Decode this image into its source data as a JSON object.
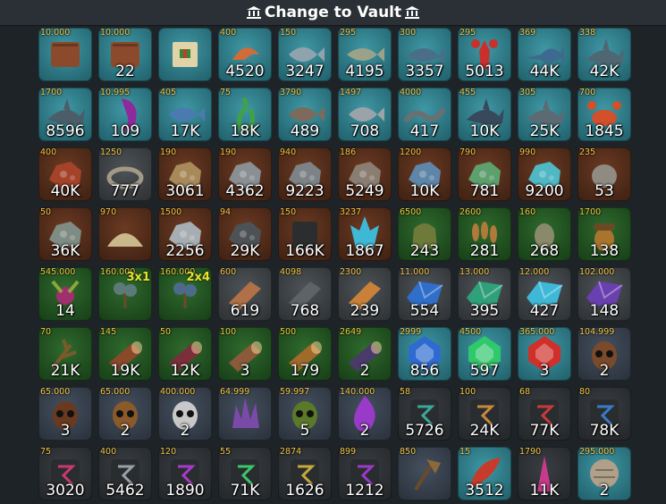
{
  "header": {
    "title": "Change to Vault",
    "icon": "vault-icon"
  },
  "rows": [
    [
      {
        "name": "book-icon",
        "price": "10.000",
        "count": "",
        "bg": "teal",
        "color": "#8b4a2b"
      },
      {
        "name": "book-icon",
        "price": "10.000",
        "count": "22",
        "bg": "teal",
        "color": "#8b4a2b"
      },
      {
        "name": "scroll-icon",
        "price": "",
        "count": "",
        "bg": "teal",
        "color": "#e0d3a8"
      },
      {
        "name": "shrimp-icon",
        "price": "400",
        "count": "4520",
        "bg": "teal",
        "color": "#d06b3a"
      },
      {
        "name": "fish-icon",
        "price": "150",
        "count": "3247",
        "bg": "teal",
        "color": "#8fa3ad"
      },
      {
        "name": "trout-icon",
        "price": "295",
        "count": "4195",
        "bg": "teal",
        "color": "#9aa38a"
      },
      {
        "name": "tuna-icon",
        "price": "300",
        "count": "3357",
        "bg": "teal",
        "color": "#4a6d88"
      },
      {
        "name": "lobster-icon",
        "price": "295",
        "count": "5013",
        "bg": "teal",
        "color": "#c9302c"
      },
      {
        "name": "swordfish-icon",
        "price": "369",
        "count": "44K",
        "bg": "teal",
        "color": "#3e6a8f"
      },
      {
        "name": "shark-icon",
        "price": "338",
        "count": "42K",
        "bg": "teal",
        "color": "#4f6673"
      }
    ],
    [
      {
        "name": "shark-icon",
        "price": "1700",
        "count": "8596",
        "bg": "teal",
        "color": "#4b5d68"
      },
      {
        "name": "tentacle-icon",
        "price": "10.995",
        "count": "109",
        "bg": "teal",
        "color": "#8f2a9c"
      },
      {
        "name": "fish-icon",
        "price": "405",
        "count": "17K",
        "bg": "teal",
        "color": "#4a7bb0"
      },
      {
        "name": "seaweed-icon",
        "price": "75",
        "count": "18K",
        "bg": "teal",
        "color": "#3fa346"
      },
      {
        "name": "fish-icon",
        "price": "3790",
        "count": "489",
        "bg": "teal",
        "color": "#7e6a5c"
      },
      {
        "name": "fish-icon",
        "price": "1497",
        "count": "708",
        "bg": "teal",
        "color": "#9aa3a8"
      },
      {
        "name": "eel-icon",
        "price": "4000",
        "count": "417",
        "bg": "teal",
        "color": "#6a6f72"
      },
      {
        "name": "shark-icon",
        "price": "455",
        "count": "10K",
        "bg": "teal",
        "color": "#37495a"
      },
      {
        "name": "shark-icon",
        "price": "305",
        "count": "25K",
        "bg": "teal",
        "color": "#5c6a73"
      },
      {
        "name": "crab-icon",
        "price": "700",
        "count": "1845",
        "bg": "teal",
        "color": "#d2502a"
      }
    ],
    [
      {
        "name": "ore-icon",
        "price": "400",
        "count": "40K",
        "bg": "brown",
        "color": "#a4432a"
      },
      {
        "name": "nest-icon",
        "price": "1250",
        "count": "777",
        "bg": "gray",
        "color": "#a39a86"
      },
      {
        "name": "ore-icon",
        "price": "190",
        "count": "3061",
        "bg": "brown",
        "color": "#a88a5a"
      },
      {
        "name": "ore-icon",
        "price": "190",
        "count": "4362",
        "bg": "brown",
        "color": "#8a8f93"
      },
      {
        "name": "ore-icon",
        "price": "940",
        "count": "9223",
        "bg": "brown",
        "color": "#7d8287"
      },
      {
        "name": "ore-icon",
        "price": "186",
        "count": "5249",
        "bg": "brown",
        "color": "#8a7d72"
      },
      {
        "name": "ore-icon",
        "price": "1200",
        "count": "10K",
        "bg": "brown",
        "color": "#5f86a8"
      },
      {
        "name": "ore-icon",
        "price": "790",
        "count": "781",
        "bg": "brown",
        "color": "#5e9f6e"
      },
      {
        "name": "ore-icon",
        "price": "990",
        "count": "9200",
        "bg": "brown",
        "color": "#4fb8c4"
      },
      {
        "name": "stone-icon",
        "price": "235",
        "count": "53",
        "bg": "brown",
        "color": "#8f8a82"
      }
    ],
    [
      {
        "name": "ore-icon",
        "price": "50",
        "count": "36K",
        "bg": "brown",
        "color": "#7f8c84"
      },
      {
        "name": "sand-icon",
        "price": "970",
        "count": "",
        "bg": "brown",
        "color": "#c9b98a"
      },
      {
        "name": "ore-icon",
        "price": "1500",
        "count": "2256",
        "bg": "brown",
        "color": "#a7aeb3"
      },
      {
        "name": "ore-icon",
        "price": "94",
        "count": "29K",
        "bg": "brown",
        "color": "#4d5256"
      },
      {
        "name": "coal-icon",
        "price": "150",
        "count": "166K",
        "bg": "brown",
        "color": "#2b2d2f"
      },
      {
        "name": "crystal-icon",
        "price": "3237",
        "count": "1867",
        "bg": "brown",
        "color": "#3fb8d6"
      },
      {
        "name": "seed-bag-icon",
        "price": "6500",
        "count": "243",
        "bg": "green",
        "color": "#6d7a3a"
      },
      {
        "name": "wheat-icon",
        "price": "2600",
        "count": "281",
        "bg": "green",
        "color": "#b07a3a"
      },
      {
        "name": "seed-icon",
        "price": "160",
        "count": "268",
        "bg": "green",
        "color": "#8a8a6a"
      },
      {
        "name": "acorn-icon",
        "price": "1700",
        "count": "138",
        "bg": "green",
        "color": "#a9752e"
      }
    ],
    [
      {
        "name": "plant-icon",
        "price": "545.000",
        "count": "14",
        "bg": "green",
        "color": "#a02f6e"
      },
      {
        "name": "sapling-icon",
        "price": "160.000",
        "count": "",
        "size": "3x1",
        "bg": "green",
        "color": "#5c7a7a"
      },
      {
        "name": "sapling-icon",
        "price": "160.000",
        "count": "",
        "size": "2x4",
        "bg": "green",
        "color": "#4c6a8a"
      },
      {
        "name": "plank-icon",
        "price": "600",
        "count": "619",
        "bg": "gray",
        "color": "#b07048"
      },
      {
        "name": "plank-icon",
        "price": "4098",
        "count": "768",
        "bg": "gray",
        "color": "#5e6366"
      },
      {
        "name": "plank-icon",
        "price": "2300",
        "count": "239",
        "bg": "gray",
        "color": "#c9813a"
      },
      {
        "name": "gem-icon",
        "price": "11.000",
        "count": "554",
        "bg": "gray",
        "color": "#2f6ec9"
      },
      {
        "name": "gem-icon",
        "price": "13.000",
        "count": "395",
        "bg": "gray",
        "color": "#2fa07a"
      },
      {
        "name": "gem-icon",
        "price": "12.000",
        "count": "427",
        "bg": "gray",
        "color": "#3fb8d8"
      },
      {
        "name": "gem-icon",
        "price": "102.000",
        "count": "148",
        "bg": "gray",
        "color": "#6a3fb0"
      }
    ],
    [
      {
        "name": "branch-icon",
        "price": "70",
        "count": "21K",
        "bg": "green",
        "color": "#7a5a2a"
      },
      {
        "name": "log-icon",
        "price": "145",
        "count": "19K",
        "bg": "green",
        "color": "#8a4a2a"
      },
      {
        "name": "log-icon",
        "price": "50",
        "count": "12K",
        "bg": "green",
        "color": "#7a2f3a"
      },
      {
        "name": "log-icon",
        "price": "100",
        "count": "3",
        "bg": "green",
        "color": "#8a5a3a"
      },
      {
        "name": "log-icon",
        "price": "500",
        "count": "179",
        "bg": "green",
        "color": "#a06a2a"
      },
      {
        "name": "log-icon",
        "price": "2649",
        "count": "2",
        "bg": "green",
        "color": "#4a3a6a"
      },
      {
        "name": "jewel-icon",
        "price": "2999",
        "count": "856",
        "bg": "teal",
        "color": "#2f6ad0"
      },
      {
        "name": "jewel-icon",
        "price": "4500",
        "count": "597",
        "bg": "teal",
        "color": "#2fc86a"
      },
      {
        "name": "jewel-icon",
        "price": "365.000",
        "count": "3",
        "bg": "teal",
        "color": "#d0302a"
      },
      {
        "name": "mask-icon",
        "price": "104.999",
        "count": "2",
        "bg": "slate",
        "color": "#7a4a2a"
      }
    ],
    [
      {
        "name": "mask-icon",
        "price": "65.000",
        "count": "3",
        "bg": "slate",
        "color": "#6a3a1f"
      },
      {
        "name": "mask-icon",
        "price": "65.000",
        "count": "2",
        "bg": "slate",
        "color": "#8a5a2a"
      },
      {
        "name": "mask-icon",
        "price": "400.000",
        "count": "2",
        "bg": "slate",
        "color": "#c8c8c8"
      },
      {
        "name": "crystal-cluster-icon",
        "price": "64.999",
        "count": "",
        "bg": "slate",
        "color": "#7a4aa8"
      },
      {
        "name": "mask-icon",
        "price": "59.997",
        "count": "5",
        "bg": "slate",
        "color": "#5a7a2a"
      },
      {
        "name": "flame-icon",
        "price": "140.000",
        "count": "2",
        "bg": "slate",
        "color": "#9a3ac8"
      },
      {
        "name": "rune-icon",
        "price": "58",
        "count": "5726",
        "bg": "dark",
        "color": "#3aa89a"
      },
      {
        "name": "rune-icon",
        "price": "100",
        "count": "24K",
        "bg": "dark",
        "color": "#c88a3a"
      },
      {
        "name": "rune-icon",
        "price": "68",
        "count": "77K",
        "bg": "dark",
        "color": "#c83a3a"
      },
      {
        "name": "rune-icon",
        "price": "80",
        "count": "78K",
        "bg": "dark",
        "color": "#3a7ac8"
      }
    ],
    [
      {
        "name": "rune-icon",
        "price": "75",
        "count": "3020",
        "bg": "dark",
        "color": "#c83a6a"
      },
      {
        "name": "rune-icon",
        "price": "400",
        "count": "5462",
        "bg": "dark",
        "color": "#9aa0a8"
      },
      {
        "name": "rune-icon",
        "price": "120",
        "count": "1890",
        "bg": "dark",
        "color": "#a83ac8"
      },
      {
        "name": "rune-icon",
        "price": "55",
        "count": "71K",
        "bg": "dark",
        "color": "#3ac86a"
      },
      {
        "name": "rune-icon",
        "price": "2874",
        "count": "1626",
        "bg": "dark",
        "color": "#c8a83a"
      },
      {
        "name": "rune-icon",
        "price": "899",
        "count": "1212",
        "bg": "dark",
        "color": "#9a3ac8"
      },
      {
        "name": "axe-icon",
        "price": "850",
        "count": "",
        "bg": "slate",
        "color": "#8a6a3a"
      },
      {
        "name": "feather-icon",
        "price": "15",
        "count": "3512",
        "bg": "teal",
        "color": "#c83a2a"
      },
      {
        "name": "spike-icon",
        "price": "1790",
        "count": "11K",
        "bg": "dark",
        "color": "#c83a8a"
      },
      {
        "name": "scale-icon",
        "price": "295.000",
        "count": "2",
        "bg": "teal",
        "color": "#b0a08a"
      }
    ]
  ]
}
